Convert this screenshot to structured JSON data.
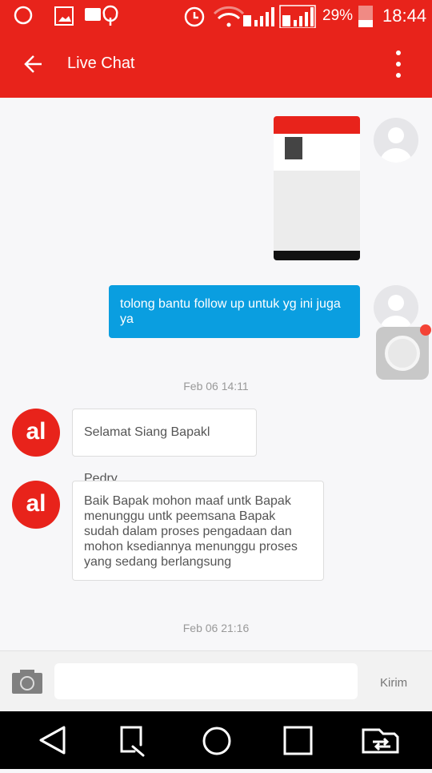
{
  "status_bar": {
    "battery": "29%",
    "time": "18:44",
    "sim1": "1",
    "sim2": "2",
    "icons": [
      "whatsapp-icon",
      "gallery-icon",
      "bbm-icon",
      "tree-icon",
      "alarm-icon",
      "wifi-icon",
      "signal-icon",
      "battery-icon"
    ]
  },
  "header": {
    "title": "Live Chat"
  },
  "messages": [
    {
      "from": "user",
      "type": "image"
    },
    {
      "from": "user",
      "text": "tolong bantu follow up untuk yg ini juga ya"
    },
    {
      "type": "date",
      "text": "Feb 06 14:11"
    },
    {
      "from": "agent",
      "avatar": "al",
      "text": "Selamat Siang Bapakl Pedry"
    },
    {
      "from": "agent",
      "avatar": "al",
      "text": "Baik Bapak mohon maaf untk Bapak menunggu untk peemsana Bapak sudah dalam proses pengadaan dan mohon ksediannya menunggu proses yang sedang berlangsung"
    },
    {
      "type": "date",
      "text": "Feb 06 21:16"
    }
  ],
  "input": {
    "placeholder": "",
    "send_label": "Kirim"
  },
  "colors": {
    "brand": "#e8231b",
    "user_bubble": "#0a9ee0"
  }
}
